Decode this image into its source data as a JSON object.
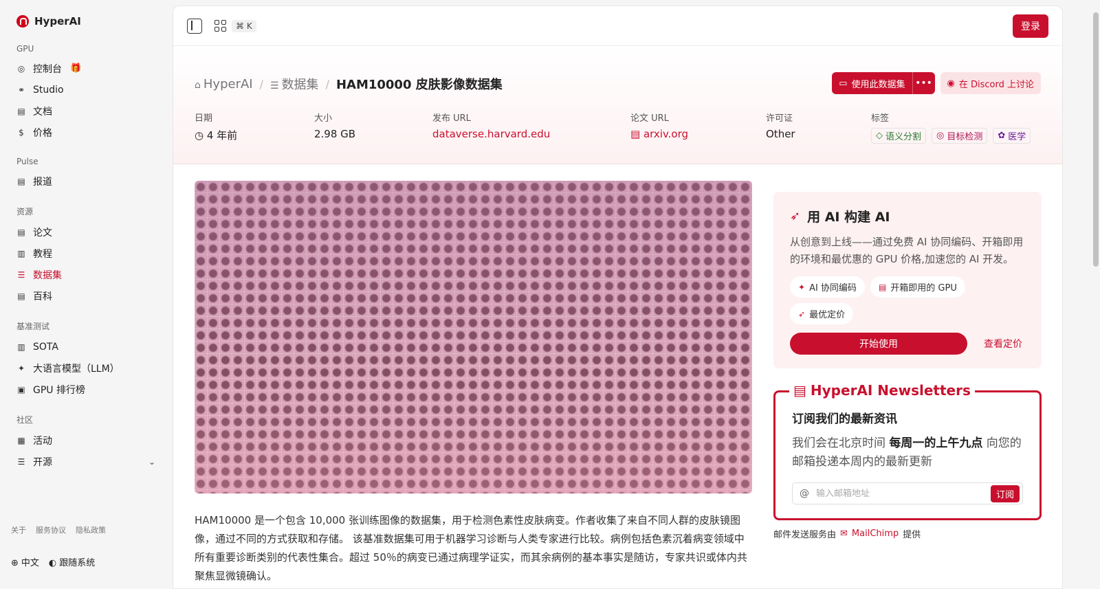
{
  "brand": {
    "name": "HyperAI"
  },
  "sidebar": {
    "sections": [
      {
        "title": "GPU",
        "items": [
          {
            "label": "控制台",
            "icon": "gauge-icon",
            "gift": true
          },
          {
            "label": "Studio",
            "icon": "link-icon"
          },
          {
            "label": "文档",
            "icon": "doc-icon"
          },
          {
            "label": "价格",
            "icon": "dollar-icon"
          }
        ]
      },
      {
        "title": "Pulse",
        "items": [
          {
            "label": "报道",
            "icon": "news-icon"
          }
        ]
      },
      {
        "title": "资源",
        "items": [
          {
            "label": "论文",
            "icon": "paper-icon"
          },
          {
            "label": "教程",
            "icon": "book-icon"
          },
          {
            "label": "数据集",
            "icon": "database-icon",
            "active": true
          },
          {
            "label": "百科",
            "icon": "wiki-icon"
          }
        ]
      },
      {
        "title": "基准测试",
        "items": [
          {
            "label": "SOTA",
            "icon": "chart-icon"
          },
          {
            "label": "大语言模型（LLM）",
            "icon": "sparkle-icon"
          },
          {
            "label": "GPU 排行榜",
            "icon": "cpu-icon"
          }
        ]
      },
      {
        "title": "社区",
        "items": [
          {
            "label": "活动",
            "icon": "calendar-icon"
          },
          {
            "label": "开源",
            "icon": "list-icon",
            "expandable": true
          }
        ]
      }
    ],
    "footer_links": [
      "关于",
      "服务协议",
      "隐私政策"
    ],
    "language": "中文",
    "theme": "跟随系统"
  },
  "topbar": {
    "shortcut": "⌘ K",
    "login_label": "登录"
  },
  "breadcrumb": {
    "home": "HyperAI",
    "section": "数据集",
    "current": "HAM10000 皮肤影像数据集"
  },
  "actions": {
    "use_dataset": "使用此数据集",
    "discord": "在 Discord 上讨论"
  },
  "meta": {
    "date_label": "日期",
    "date_value": "4 年前",
    "size_label": "大小",
    "size_value": "2.98 GB",
    "release_label": "发布 URL",
    "release_value": "dataverse.harvard.edu",
    "paper_label": "论文 URL",
    "paper_value": "arxiv.org",
    "license_label": "许可证",
    "license_value": "Other",
    "tags_label": "标签",
    "tags": [
      "语义分割",
      "目标检测",
      "医学"
    ]
  },
  "description": "HAM10000 是一个包含 10,000 张训练图像的数据集，用于检测色素性皮肤病变。作者收集了来自不同人群的皮肤镜图像，通过不同的方式获取和存储。 该基准数据集可用于机器学习诊断与人类专家进行比较。病例包括色素沉着病变领域中所有重要诊断类别的代表性集合。超过 50％的病变已通过病理学证实，而其余病例的基本事实是随访，专家共识或体内共聚焦显微镜确认。",
  "ai_card": {
    "title": "用 AI 构建 AI",
    "desc": "从创意到上线——通过免费 AI 协同编码、开箱即用的环境和最优惠的 GPU 价格,加速您的 AI 开发。",
    "chips": [
      "AI 协同编码",
      "开箱即用的 GPU",
      "最优定价"
    ],
    "start": "开始使用",
    "pricing": "查看定价"
  },
  "newsletter": {
    "legend": "HyperAI Newsletters",
    "heading": "订阅我们的最新资讯",
    "text_before": "我们会在北京时间 ",
    "text_bold": "每周一的上午九点",
    "text_after": " 向您的邮箱投递本周内的最新更新",
    "placeholder": "输入邮箱地址",
    "subscribe": "订阅",
    "powered_before": "邮件发送服务由",
    "powered_brand": "MailChimp",
    "powered_after": "提供"
  }
}
